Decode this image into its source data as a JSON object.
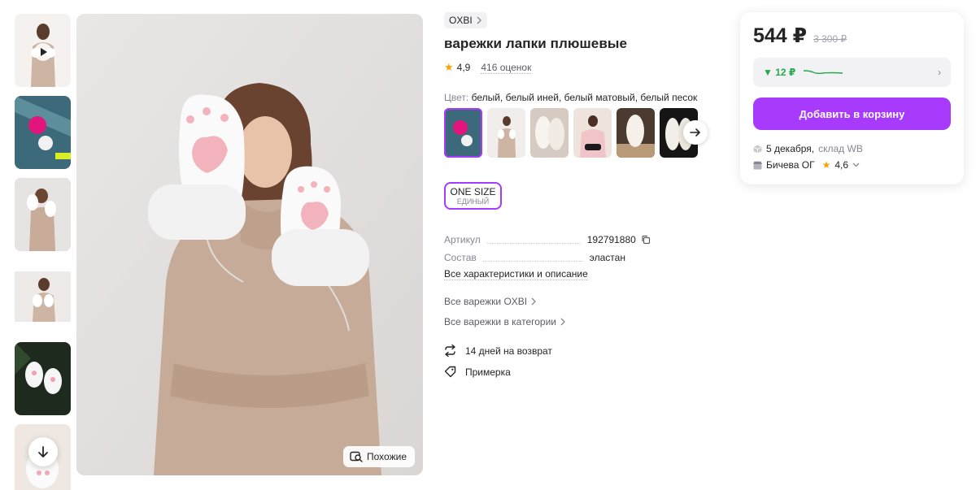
{
  "product": {
    "brand": "OXBI",
    "title": "варежки лапки плюшевые",
    "rating": "4,9",
    "reviews": "416 оценок",
    "color_label": "Цвет:",
    "color_value": "белый, белый иней, белый матовый, белый песок",
    "size": {
      "label": "ONE SIZE",
      "sub": "ЕДИНЫЙ"
    },
    "specs": [
      {
        "key": "Артикул",
        "value": "192791880"
      },
      {
        "key": "Состав",
        "value": "эластан"
      }
    ],
    "all_chars_link": "Все характеристики и описание",
    "links": [
      "Все варежки OXBI",
      "Все варежки в категории"
    ],
    "features": [
      "14 дней на возврат",
      "Примерка"
    ]
  },
  "gallery": {
    "similar_button": "Похожие",
    "thumb_count": 6,
    "active_thumb": 3
  },
  "card": {
    "price": "544 ₽",
    "old_price": "3 300 ₽",
    "price_history_delta": "▼ 12 ₽",
    "add_to_cart": "Добавить в корзину",
    "delivery_date": "5 декабря,",
    "warehouse": "склад WB",
    "seller_name": "Бичева ОГ",
    "seller_rating": "4,6"
  },
  "colors": {
    "accent": "#a73afd",
    "price_drop": "#27a94e",
    "star": "#ff9f00"
  },
  "icons": [
    "play-icon",
    "arrow-down-icon",
    "search-similar-icon",
    "chevron-right-icon",
    "arrow-right-icon",
    "copy-icon",
    "return-icon",
    "tag-icon",
    "box-icon",
    "shop-icon",
    "star-icon",
    "chevron-down-icon"
  ]
}
